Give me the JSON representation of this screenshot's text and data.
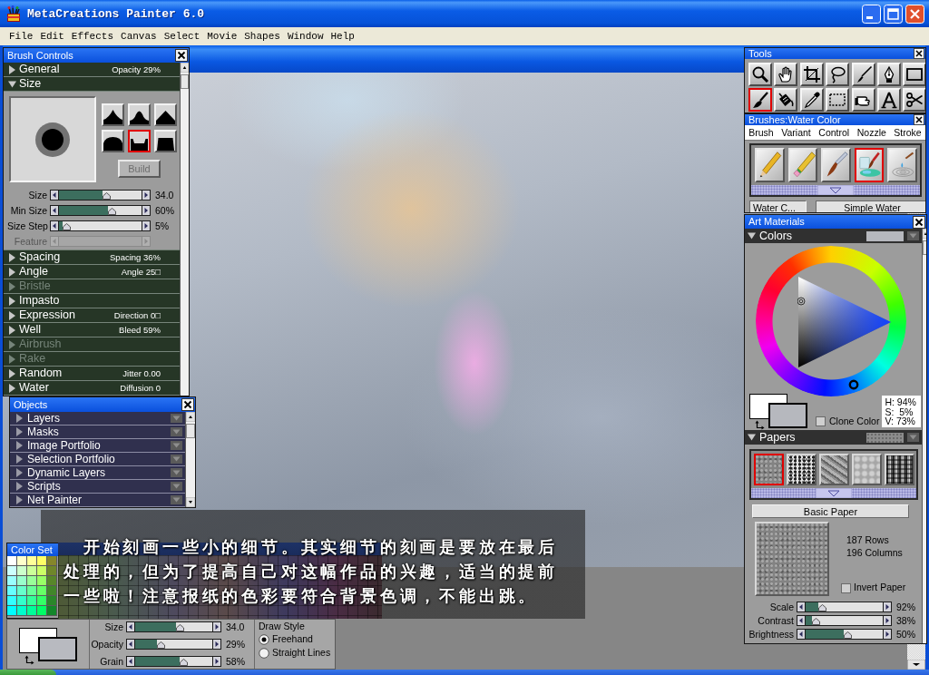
{
  "window": {
    "title": "MetaCreations Painter 6.0"
  },
  "menu": [
    "File",
    "Edit",
    "Effects",
    "Canvas",
    "Select",
    "Movie",
    "Shapes",
    "Window",
    "Help"
  ],
  "brush_controls": {
    "title": "Brush Controls",
    "sections": [
      {
        "label": "General",
        "value": "Opacity 29%",
        "expanded": false,
        "disabled": false
      },
      {
        "label": "Size",
        "expanded": true,
        "disabled": false,
        "panel": {
          "profiles": [
            {
              "kind": "pointed",
              "selected": false
            },
            {
              "kind": "medium",
              "selected": false
            },
            {
              "kind": "linear",
              "selected": false
            },
            {
              "kind": "dull",
              "selected": false
            },
            {
              "kind": "watercolor",
              "selected": true
            },
            {
              "kind": "flat",
              "selected": false
            }
          ],
          "build_button": {
            "label": "Build",
            "disabled": true
          },
          "sliders": [
            {
              "label": "Size",
              "level": 0.53,
              "reading": "34.0",
              "disabled": false
            },
            {
              "label": "Min Size",
              "level": 0.59,
              "reading": "60%",
              "disabled": false
            },
            {
              "label": "Size Step",
              "level": 0.04,
              "reading": "5%",
              "disabled": false
            },
            {
              "label": "Feature",
              "disabled": true
            }
          ]
        }
      },
      {
        "label": "Spacing",
        "value": "Spacing 36%",
        "expanded": false,
        "disabled": false
      },
      {
        "label": "Angle",
        "value": "Angle 25□",
        "expanded": false,
        "disabled": false
      },
      {
        "label": "Bristle",
        "expanded": false,
        "disabled": true
      },
      {
        "label": "Impasto",
        "expanded": false,
        "disabled": false
      },
      {
        "label": "Expression",
        "value": "Direction 0□",
        "expanded": false,
        "disabled": false
      },
      {
        "label": "Well",
        "value": "Bleed 59%",
        "expanded": false,
        "disabled": false
      },
      {
        "label": "Airbrush",
        "expanded": false,
        "disabled": true
      },
      {
        "label": "Rake",
        "expanded": false,
        "disabled": true
      },
      {
        "label": "Random",
        "value": "Jitter 0.00",
        "expanded": false,
        "disabled": false
      },
      {
        "label": "Water",
        "value": "Diffusion 0",
        "expanded": false,
        "disabled": false
      }
    ]
  },
  "objects": {
    "title": "Objects",
    "items": [
      {
        "label": "Layers",
        "expanded": false
      },
      {
        "label": "Masks",
        "expanded": false
      },
      {
        "label": "Image Portfolio",
        "expanded": false
      },
      {
        "label": "Selection Portfolio",
        "expanded": false
      },
      {
        "label": "Dynamic Layers",
        "expanded": false
      },
      {
        "label": "Scripts",
        "expanded": false
      },
      {
        "label": "Net Painter",
        "expanded": false
      }
    ]
  },
  "color_set": {
    "title": "Color Set",
    "swatches": [
      {
        "color": "#ffffff"
      },
      {
        "color": "#ffffcc"
      },
      {
        "color": "#ffff99"
      },
      {
        "color": "#ffff66"
      },
      {
        "color": "#86862a"
      },
      {
        "color": "#ccffff"
      },
      {
        "color": "#ccffcc"
      },
      {
        "color": "#ccff99"
      },
      {
        "color": "#ccff66"
      },
      {
        "color": "#6f862a"
      },
      {
        "color": "#99ffff"
      },
      {
        "color": "#99ffcc"
      },
      {
        "color": "#99ff99"
      },
      {
        "color": "#99ff66"
      },
      {
        "color": "#58862a"
      },
      {
        "color": "#66ffff"
      },
      {
        "color": "#66ffcc"
      },
      {
        "color": "#66ff99"
      },
      {
        "color": "#66ff66"
      },
      {
        "color": "#41862a"
      },
      {
        "color": "#33ffff"
      },
      {
        "color": "#33ffcc"
      },
      {
        "color": "#33ff99"
      },
      {
        "color": "#33ff66"
      },
      {
        "color": "#2a862a"
      },
      {
        "color": "#00ffff"
      },
      {
        "color": "#00ffcc"
      },
      {
        "color": "#00ff99"
      },
      {
        "color": "#00ff66"
      },
      {
        "color": "#13862a"
      }
    ]
  },
  "bottom_bar": {
    "swatches": [
      {
        "color": "#ffffff"
      },
      {
        "color": "#b8bac0"
      }
    ],
    "sliders": [
      {
        "label": "Size",
        "level": 0.53,
        "reading": "34.0"
      },
      {
        "label": "Opacity",
        "level": 0.28,
        "reading": "29%"
      },
      {
        "label": "Grain",
        "level": 0.58,
        "reading": "58%"
      }
    ],
    "draw_style": {
      "label": "Draw Style",
      "options": [
        {
          "label": "Freehand",
          "selected": true
        },
        {
          "label": "Straight Lines",
          "selected": false
        }
      ]
    }
  },
  "tools": {
    "title": "Tools",
    "items": [
      {
        "kind": "magnifier",
        "selected": false
      },
      {
        "kind": "hand",
        "selected": false
      },
      {
        "kind": "crop",
        "selected": false
      },
      {
        "kind": "lasso",
        "selected": false
      },
      {
        "kind": "brush",
        "selected": false
      },
      {
        "kind": "pen",
        "selected": false
      },
      {
        "kind": "rectangle",
        "selected": false
      },
      {
        "kind": "paintbrush",
        "selected": true
      },
      {
        "kind": "bucket",
        "selected": false
      },
      {
        "kind": "dropper",
        "selected": false
      },
      {
        "kind": "marquee",
        "selected": false
      },
      {
        "kind": "pointer",
        "selected": false
      },
      {
        "kind": "text",
        "selected": false
      },
      {
        "kind": "scissors",
        "selected": false
      }
    ]
  },
  "brushes": {
    "title": "Brushes:Water Color",
    "menu": [
      "Brush",
      "Variant",
      "Control",
      "Nozzle",
      "Stroke"
    ],
    "items": [
      {
        "kind": "pencil",
        "selected": false
      },
      {
        "kind": "eraser",
        "selected": false
      },
      {
        "kind": "brush",
        "selected": false
      },
      {
        "kind": "watercolor",
        "selected": true
      },
      {
        "kind": "drop",
        "selected": false
      }
    ],
    "category": "Water C...",
    "variant": "Simple Water"
  },
  "art_materials": {
    "title": "Art Materials",
    "colors": {
      "label": "Colors",
      "expanded": true,
      "swatches": [
        {
          "color": "#ffffff"
        },
        {
          "color": "#b6b8be"
        }
      ],
      "clone_color": {
        "label": "Clone Color",
        "checked": false
      },
      "readout": [
        "H: 94%",
        "S:  5%",
        "V: 73%"
      ]
    },
    "papers": {
      "label": "Papers",
      "expanded": true,
      "items": [
        {
          "kind": "grain",
          "selected": true
        },
        {
          "kind": "speckle",
          "selected": false
        },
        {
          "kind": "rough",
          "selected": false
        },
        {
          "kind": "soft",
          "selected": false
        },
        {
          "kind": "weave",
          "selected": false
        }
      ],
      "name": "Basic Paper",
      "info": [
        "187 Rows",
        "196 Columns"
      ],
      "invert": {
        "label": "Invert Paper",
        "checked": false
      },
      "sliders": [
        {
          "label": "Scale",
          "level": 0.17,
          "reading": "92%"
        },
        {
          "label": "Contrast",
          "level": 0.08,
          "reading": "38%"
        },
        {
          "label": "Brightness",
          "level": 0.49,
          "reading": "50%"
        }
      ]
    }
  },
  "caption": {
    "text": "开始刻画一些小的细节。其实细节的刻画是要放在最后处理的，但为了提高自己对这幅作品的兴趣，适当的提前一些啦！注意报纸的色彩要符合背景色调，不能出跳。"
  }
}
